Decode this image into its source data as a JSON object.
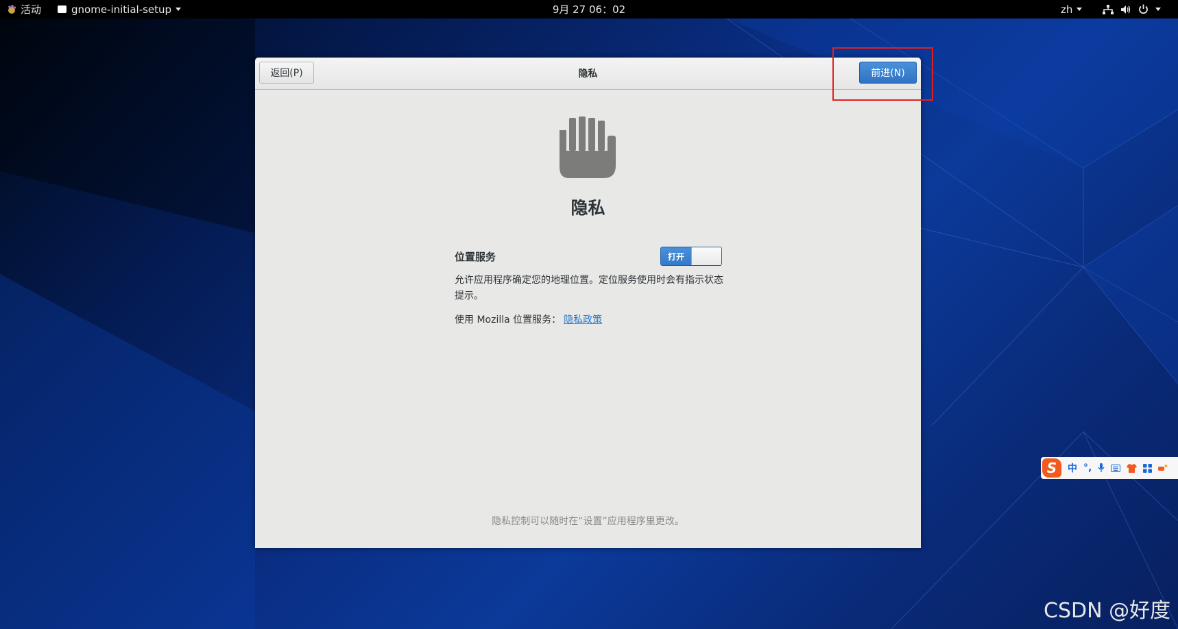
{
  "topbar": {
    "activities": "活动",
    "app_menu": "gnome-initial-setup",
    "clock": "9月 27  06：02",
    "language": "zh"
  },
  "dialog": {
    "back_button": "返回(P)",
    "header_title": "隐私",
    "next_button": "前进(N)",
    "page_heading": "隐私",
    "location": {
      "label": "位置服务",
      "toggle_state": "打开",
      "description": "允许应用程序确定您的地理位置。定位服务使用时会有指示状态提示。",
      "mozilla_prefix": "使用 Mozilla 位置服务：",
      "privacy_link": "隐私政策"
    },
    "footer_note": "隐私控制可以随时在“设置”应用程序里更改。"
  },
  "ime": {
    "mode": "中",
    "punct": "°,"
  },
  "watermark": "CSDN @好度",
  "colors": {
    "accent": "#3579c9",
    "highlight": "#e02020"
  }
}
